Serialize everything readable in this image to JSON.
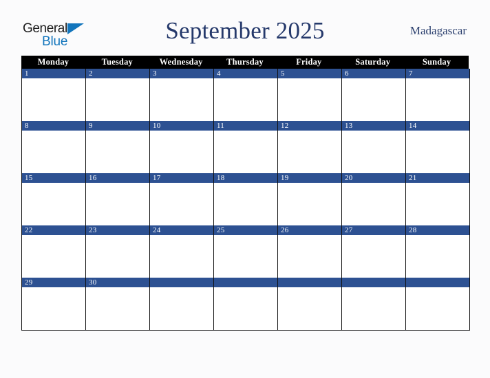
{
  "brand": {
    "name_top": "General",
    "name_bottom": "Blue",
    "triangle_color": "#1275bc",
    "top_color": "#1b1b1b"
  },
  "header": {
    "title": "September 2025",
    "locale": "Madagascar",
    "title_color": "#25396b",
    "locale_color": "#2b3f6e"
  },
  "calendar": {
    "month": "September",
    "year": "2025",
    "weekday_headers": [
      "Monday",
      "Tuesday",
      "Wednesday",
      "Thursday",
      "Friday",
      "Saturday",
      "Sunday"
    ],
    "header_background": "#000000",
    "header_text_color": "#ffffff",
    "date_band_color": "#2d5192",
    "date_text_color": "#ffffff",
    "cell_background": "#ffffff",
    "grid_line_color": "#111111",
    "weeks": [
      {
        "days": [
          {
            "date": "1"
          },
          {
            "date": "2"
          },
          {
            "date": "3"
          },
          {
            "date": "4"
          },
          {
            "date": "5"
          },
          {
            "date": "6"
          },
          {
            "date": "7"
          }
        ]
      },
      {
        "days": [
          {
            "date": "8"
          },
          {
            "date": "9"
          },
          {
            "date": "10"
          },
          {
            "date": "11"
          },
          {
            "date": "12"
          },
          {
            "date": "13"
          },
          {
            "date": "14"
          }
        ]
      },
      {
        "days": [
          {
            "date": "15"
          },
          {
            "date": "16"
          },
          {
            "date": "17"
          },
          {
            "date": "18"
          },
          {
            "date": "19"
          },
          {
            "date": "20"
          },
          {
            "date": "21"
          }
        ]
      },
      {
        "days": [
          {
            "date": "22"
          },
          {
            "date": "23"
          },
          {
            "date": "24"
          },
          {
            "date": "25"
          },
          {
            "date": "26"
          },
          {
            "date": "27"
          },
          {
            "date": "28"
          }
        ]
      },
      {
        "days": [
          {
            "date": "29"
          },
          {
            "date": "30"
          },
          {
            "date": ""
          },
          {
            "date": ""
          },
          {
            "date": ""
          },
          {
            "date": ""
          },
          {
            "date": ""
          }
        ]
      }
    ]
  }
}
